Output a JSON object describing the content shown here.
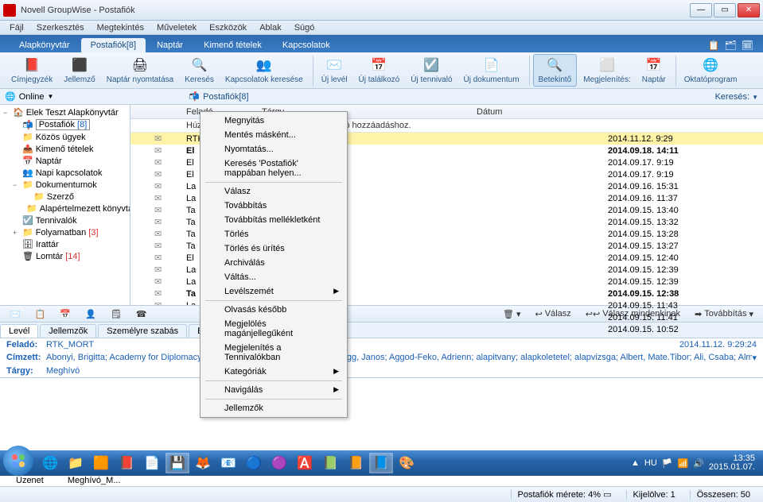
{
  "title": "Novell GroupWise - Postafiók",
  "menubar": [
    "Fájl",
    "Szerkesztés",
    "Megtekintés",
    "Műveletek",
    "Eszközök",
    "Ablak",
    "Súgó"
  ],
  "maintabs": [
    {
      "label": "Alapkönyvtár"
    },
    {
      "label": "Postafiók[8]",
      "active": true
    },
    {
      "label": "Naptár"
    },
    {
      "label": "Kimenő tételek"
    },
    {
      "label": "Kapcsolatok"
    }
  ],
  "toolbar": [
    {
      "label": "Címjegyzék",
      "icon": "📕"
    },
    {
      "label": "Jellemző",
      "icon": "⬛"
    },
    {
      "label": "Naptár nyomtatása",
      "icon": "🖨"
    },
    {
      "label": "Keresés",
      "icon": "🔍"
    },
    {
      "label": "Kapcsolatok keresése",
      "icon": "👥"
    },
    {
      "label": "Új levél",
      "icon": "✉️"
    },
    {
      "label": "Új találkozó",
      "icon": "📅"
    },
    {
      "label": "Új tennivaló",
      "icon": "☑️"
    },
    {
      "label": "Új dokumentum",
      "icon": "📄"
    },
    {
      "label": "Betekintő",
      "icon": "🔍",
      "active": true
    },
    {
      "label": "Megjelenítés:",
      "icon": "⬜"
    },
    {
      "label": "Naptár",
      "icon": "📅"
    },
    {
      "label": "Oktatóprogram",
      "icon": "🌐"
    }
  ],
  "online": {
    "label": "Online",
    "crumb": "Postafiók[8]",
    "search": "Keresés:"
  },
  "tree": [
    {
      "t": "Elek Teszt Alapkönyvtár",
      "i": "🏠",
      "lvl": 0,
      "exp": "−"
    },
    {
      "t": "Postafiók",
      "i": "📬",
      "lvl": 1,
      "exp": "",
      "count": "[8]",
      "boxed": true
    },
    {
      "t": "Közös ügyek",
      "i": "📁",
      "lvl": 1,
      "exp": ""
    },
    {
      "t": "Kimenő tételek",
      "i": "📤",
      "lvl": 1,
      "exp": ""
    },
    {
      "t": "Naptár",
      "i": "📅",
      "lvl": 1,
      "exp": ""
    },
    {
      "t": "Napi kapcsolatok",
      "i": "👥",
      "lvl": 1,
      "exp": ""
    },
    {
      "t": "Dokumentumok",
      "i": "📁",
      "lvl": 1,
      "exp": "−"
    },
    {
      "t": "Szerző",
      "i": "📁",
      "lvl": 2,
      "exp": ""
    },
    {
      "t": "Alapértelmezett könyvtár",
      "i": "📁",
      "lvl": 2,
      "exp": ""
    },
    {
      "t": "Tennivalók",
      "i": "☑️",
      "lvl": 1,
      "exp": ""
    },
    {
      "t": "Folyamatban",
      "i": "📁",
      "lvl": 1,
      "exp": "+",
      "count": "[3]",
      "red": true
    },
    {
      "t": "Irattár",
      "i": "🗄",
      "lvl": 1,
      "exp": ""
    },
    {
      "t": "Lomtár",
      "i": "🗑",
      "lvl": 1,
      "exp": "",
      "count": "[14]",
      "red": true
    }
  ],
  "columns": {
    "sender": "Feladó",
    "subject": "Tárgy",
    "date": "Dátum"
  },
  "hint": "Húzza ide a tételeket a tennivalókhoz való hozzáadáshoz.",
  "rows": [
    {
      "s": "RTK_MORT",
      "d": "2014.11.12. 9:29",
      "sel": true
    },
    {
      "s": "El",
      "d": "2014.09.18. 14:11",
      "bold": true
    },
    {
      "s": "El",
      "d": "2014.09.17. 9:19"
    },
    {
      "s": "El",
      "d": "2014.09.17. 9:19"
    },
    {
      "s": "La",
      "d": "2014.09.16. 15:31"
    },
    {
      "s": "La",
      "d": "2014.09.16. 11:37"
    },
    {
      "s": "Ta",
      "d": "2014.09.15. 13:40"
    },
    {
      "s": "Ta",
      "d": "2014.09.15. 13:32"
    },
    {
      "s": "Ta",
      "d": "2014.09.15. 13:28"
    },
    {
      "s": "Ta",
      "d": "2014.09.15. 13:27"
    },
    {
      "s": "El",
      "d": "2014.09.15. 12:40"
    },
    {
      "s": "La",
      "d": "2014.09.15. 12:39"
    },
    {
      "s": "La",
      "d": "2014.09.15. 12:39"
    },
    {
      "s": "Ta",
      "d": "2014.09.15. 12:38",
      "bold": true
    },
    {
      "s": "La",
      "d": "2014.09.15. 11:43"
    },
    {
      "s": "La",
      "d": "2014.09.15. 11:41"
    },
    {
      "s": "La",
      "d": "2014.09.15. 10:52"
    }
  ],
  "ctx": [
    {
      "t": "Megnyitás"
    },
    {
      "t": "Mentés másként..."
    },
    {
      "t": "Nyomtatás..."
    },
    {
      "t": "Keresés 'Postafiók' mappában helyen..."
    },
    {
      "sep": true
    },
    {
      "t": "Válasz"
    },
    {
      "t": "Továbbítás"
    },
    {
      "t": "Továbbítás mellékletként"
    },
    {
      "t": "Törlés"
    },
    {
      "t": "Törlés és ürítés"
    },
    {
      "t": "Archiválás"
    },
    {
      "t": "Váltás..."
    },
    {
      "t": "Levélszemét",
      "sub": true
    },
    {
      "sep": true
    },
    {
      "t": "Olvasás később"
    },
    {
      "t": "Megjelölés magánjellegűként"
    },
    {
      "t": "Megjelenítés a Tennivalókban"
    },
    {
      "t": "Kategóriák",
      "sub": true
    },
    {
      "sep": true
    },
    {
      "t": "Navigálás",
      "sub": true
    },
    {
      "sep": true
    },
    {
      "t": "Jellemzők"
    }
  ],
  "prevtb": {
    "reply": "Válasz",
    "replyall": "Válasz mindenkinek",
    "forward": "Továbbítás"
  },
  "prevtabs": [
    "Levél",
    "Jellemzők",
    "Személyre szabás",
    "Beszélgetés"
  ],
  "hdr": {
    "from_k": "Feladó:",
    "from_v": "RTK_MORT",
    "ts": "2014.11.12. 9:29:24",
    "to_k": "Címzett:",
    "to_v": "Abonyi, Brigitta; Academy for Diplomacy and Public Serv…                            Robert; AFDSE; Agg, Janos; Aggod-Feko, Adrienn; alapitvany; alapkoletetel; alapvizsga; Albert, Mate.Tibor; Ali, Csaba; Almasy, Gyula; Amberg, Erzs…",
    "subj_k": "Tárgy:",
    "subj_v": "Meghívó"
  },
  "attach": [
    {
      "name": "Üzenet",
      "icon": "✉️"
    },
    {
      "name": "Meghívó_M...",
      "icon": "📕"
    }
  ],
  "status": {
    "size": "Postafiók mérete: 4%",
    "sel": "Kijelölve: 1",
    "total": "Összesen: 50"
  },
  "tray": {
    "lang": "HU",
    "time": "13:35",
    "date": "2015.01.07."
  }
}
